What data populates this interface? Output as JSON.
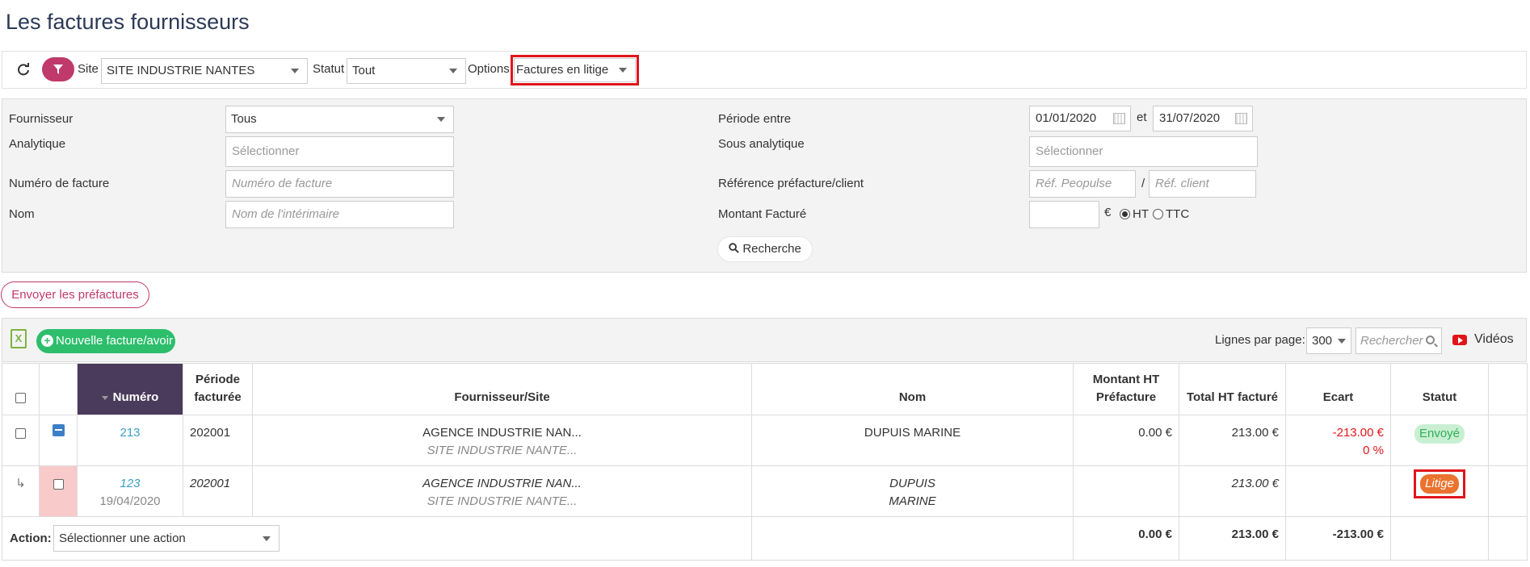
{
  "page": {
    "title": "Les factures fournisseurs"
  },
  "toolbar": {
    "site_label": "Site",
    "site_value": "SITE INDUSTRIE NANTES",
    "statut_label": "Statut",
    "statut_value": "Tout",
    "options_label": "Options",
    "options_value": "Factures en litige",
    "refresh_icon": "refresh-icon",
    "filter_icon": "filter-icon"
  },
  "filters": {
    "fournisseur_label": "Fournisseur",
    "fournisseur_value": "Tous",
    "analytique_label": "Analytique",
    "analytique_placeholder": "Sélectionner",
    "numero_label": "Numéro de facture",
    "numero_placeholder": "Numéro de facture",
    "nom_label": "Nom",
    "nom_placeholder": "Nom de l'intérimaire",
    "periode_label": "Période entre",
    "periode_start": "01/01/2020",
    "periode_et": "et",
    "periode_end": "31/07/2020",
    "sous_analytique_label": "Sous analytique",
    "sous_analytique_placeholder": "Sélectionner",
    "reference_label": "Référence préfacture/client",
    "ref_peopulse_placeholder": "Réf. Peopulse",
    "ref_separator": "/",
    "ref_client_placeholder": "Réf. client",
    "montant_label": "Montant Facturé",
    "montant_currency": "€",
    "ht_label": "HT",
    "ttc_label": "TTC",
    "search_button": "Recherche"
  },
  "actions": {
    "send_prefactures": "Envoyer les préfactures"
  },
  "table_toolbar": {
    "xls_icon_letter": "X",
    "new_button": "Nouvelle facture/avoir",
    "lines_label": "Lignes par page:",
    "lines_value": "300",
    "search_placeholder": "Rechercher",
    "videos_label": "Vidéos"
  },
  "table": {
    "headers": {
      "numero": "Numéro",
      "periode": "Période facturée",
      "fournisseur": "Fournisseur/Site",
      "nom": "Nom",
      "montant_prefacture": "Montant HT Préfacture",
      "total_ht": "Total HT facturé",
      "ecart": "Ecart",
      "statut": "Statut"
    },
    "rows": [
      {
        "numero": "213",
        "date": "",
        "periode": "202001",
        "fournisseur": "AGENCE INDUSTRIE NAN...",
        "site": "SITE INDUSTRIE NANTE...",
        "nom": "DUPUIS MARINE",
        "montant_prefacture": "0.00 €",
        "total_ht": "213.00 €",
        "ecart": "-213.00 €",
        "ecart_pct": "0 %",
        "statut": "Envoyé"
      },
      {
        "numero": "123",
        "date": "19/04/2020",
        "periode": "202001",
        "fournisseur": "AGENCE INDUSTRIE NAN...",
        "site": "SITE INDUSTRIE NANTE...",
        "nom_line1": "DUPUIS",
        "nom_line2": "MARINE",
        "montant_prefacture": "",
        "total_ht": "213.00 €",
        "ecart": "",
        "statut": "Litige"
      }
    ],
    "footer": {
      "action_label": "Action:",
      "action_value": "Sélectionner une action",
      "montant_total": "0.00 €",
      "total_ht": "213.00 €",
      "ecart_total": "-213.00 €"
    }
  },
  "colors": {
    "accent": "#c0396b",
    "success": "#2dbe6c",
    "litige": "#e9732f",
    "highlight": "#e0151b",
    "header_sorted": "#4a3b5c"
  }
}
